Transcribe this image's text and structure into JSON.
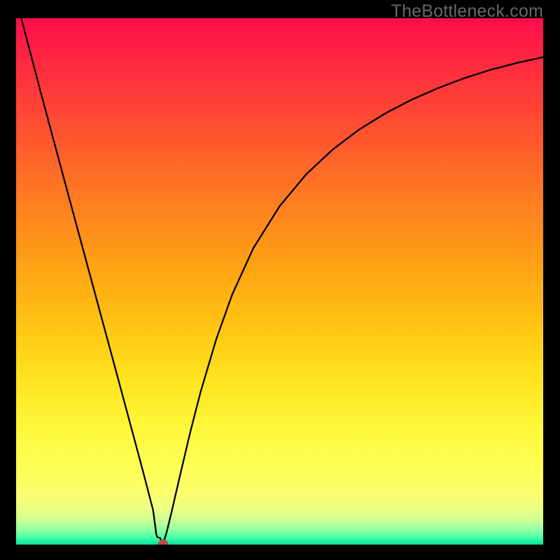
{
  "watermark": "TheBottleneck.com",
  "colors": {
    "marker": "#bb4f47",
    "curve": "#000000",
    "background": "#000000"
  },
  "gradient_stops": [
    {
      "offset": 0.0,
      "color": "#ff0d4b"
    },
    {
      "offset": 0.1,
      "color": "#ff2e3e"
    },
    {
      "offset": 0.22,
      "color": "#ff5430"
    },
    {
      "offset": 0.35,
      "color": "#ff7e21"
    },
    {
      "offset": 0.47,
      "color": "#ffa215"
    },
    {
      "offset": 0.58,
      "color": "#ffc313"
    },
    {
      "offset": 0.68,
      "color": "#ffe21e"
    },
    {
      "offset": 0.78,
      "color": "#fff83b"
    },
    {
      "offset": 0.86,
      "color": "#feff58"
    },
    {
      "offset": 0.905,
      "color": "#fbff71"
    },
    {
      "offset": 0.935,
      "color": "#eaff86"
    },
    {
      "offset": 0.955,
      "color": "#c8ff96"
    },
    {
      "offset": 0.972,
      "color": "#92ffa2"
    },
    {
      "offset": 0.985,
      "color": "#4fffaa"
    },
    {
      "offset": 1.0,
      "color": "#00e49b"
    }
  ],
  "chart_data": {
    "type": "line",
    "title": "",
    "xlabel": "",
    "ylabel": "",
    "xlim": [
      0,
      100
    ],
    "ylim": [
      0,
      100
    ],
    "minimum_point": {
      "x": 27.85,
      "y": 0.0
    },
    "series": [
      {
        "name": "bottleneck",
        "points": [
          {
            "x": 0.0,
            "y": 103.7
          },
          {
            "x": 5.0,
            "y": 84.7
          },
          {
            "x": 10.0,
            "y": 66.1
          },
          {
            "x": 15.0,
            "y": 47.6
          },
          {
            "x": 20.0,
            "y": 29.1
          },
          {
            "x": 24.0,
            "y": 14.2
          },
          {
            "x": 26.0,
            "y": 6.5
          },
          {
            "x": 26.6,
            "y": 1.9
          },
          {
            "x": 26.8,
            "y": 1.4
          },
          {
            "x": 27.3,
            "y": 1.3
          },
          {
            "x": 27.85,
            "y": 0.0
          },
          {
            "x": 28.6,
            "y": 2.5
          },
          {
            "x": 29.5,
            "y": 6.2
          },
          {
            "x": 31.0,
            "y": 12.7
          },
          {
            "x": 33.0,
            "y": 21.2
          },
          {
            "x": 35.0,
            "y": 29.0
          },
          {
            "x": 38.0,
            "y": 39.1
          },
          {
            "x": 41.0,
            "y": 47.5
          },
          {
            "x": 45.0,
            "y": 56.3
          },
          {
            "x": 50.0,
            "y": 64.3
          },
          {
            "x": 55.0,
            "y": 70.3
          },
          {
            "x": 60.0,
            "y": 75.0
          },
          {
            "x": 65.0,
            "y": 78.8
          },
          {
            "x": 70.0,
            "y": 81.9
          },
          {
            "x": 75.0,
            "y": 84.5
          },
          {
            "x": 80.0,
            "y": 86.7
          },
          {
            "x": 85.0,
            "y": 88.6
          },
          {
            "x": 90.0,
            "y": 90.2
          },
          {
            "x": 95.0,
            "y": 91.5
          },
          {
            "x": 100.0,
            "y": 92.6
          }
        ]
      }
    ]
  }
}
